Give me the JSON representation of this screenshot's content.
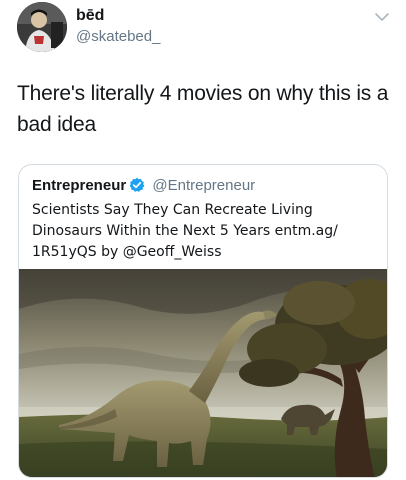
{
  "author": {
    "display_name": "bēd",
    "handle": "@skatebed_"
  },
  "tweet": {
    "text": "There's literally 4 movies on why this is a bad idea"
  },
  "quoted_tweet": {
    "display_name": "Entrepreneur",
    "handle": "@Entrepreneur",
    "verified": true,
    "text": "Scientists Say They Can Recreate Living Dinosaurs Within the Next 5 Years entm.ag/ 1R51yQS by @Geoff_Weiss"
  },
  "icons": {
    "menu": "chevron-down-icon",
    "verified": "verified-badge-icon"
  },
  "colors": {
    "text_primary": "#14171a",
    "text_secondary": "#657786",
    "verified_blue": "#1da1f2",
    "card_border": "#d4dbe1"
  }
}
